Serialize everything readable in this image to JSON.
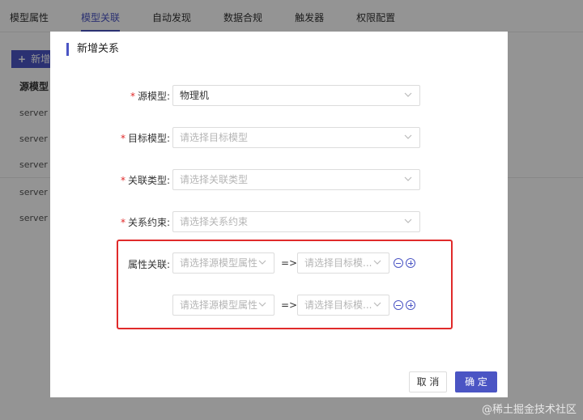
{
  "background": {
    "tabs": [
      "模型属性",
      "模型关联",
      "自动发现",
      "数据合规",
      "触发器",
      "权限配置"
    ],
    "active_tab_index": 1,
    "add_button": "新增",
    "table_header": "源模型",
    "rows": [
      "server",
      "server",
      "server",
      "server",
      "server"
    ]
  },
  "modal": {
    "title": "新增关系",
    "fields": {
      "source_model": {
        "label": "源模型:",
        "value": "物理机"
      },
      "target_model": {
        "label": "目标模型:",
        "placeholder": "请选择目标模型"
      },
      "relation_type": {
        "label": "关联类型:",
        "placeholder": "请选择关联类型"
      },
      "relation_constraint": {
        "label": "关系约束:",
        "placeholder": "请选择关系约束"
      }
    },
    "attribute_mapping": {
      "label": "属性关联:",
      "arrow": "=>",
      "rows": [
        {
          "source_placeholder": "请选择源模型属性",
          "target_placeholder": "请选择目标模..."
        },
        {
          "source_placeholder": "请选择源模型属性",
          "target_placeholder": "请选择目标模..."
        }
      ]
    },
    "buttons": {
      "cancel": "取 消",
      "ok": "确 定"
    }
  },
  "watermark": "@稀土掘金技术社区",
  "colors": {
    "accent": "#4b55c4",
    "required": "#e02a2a",
    "highlight_box": "#e02a2a"
  }
}
